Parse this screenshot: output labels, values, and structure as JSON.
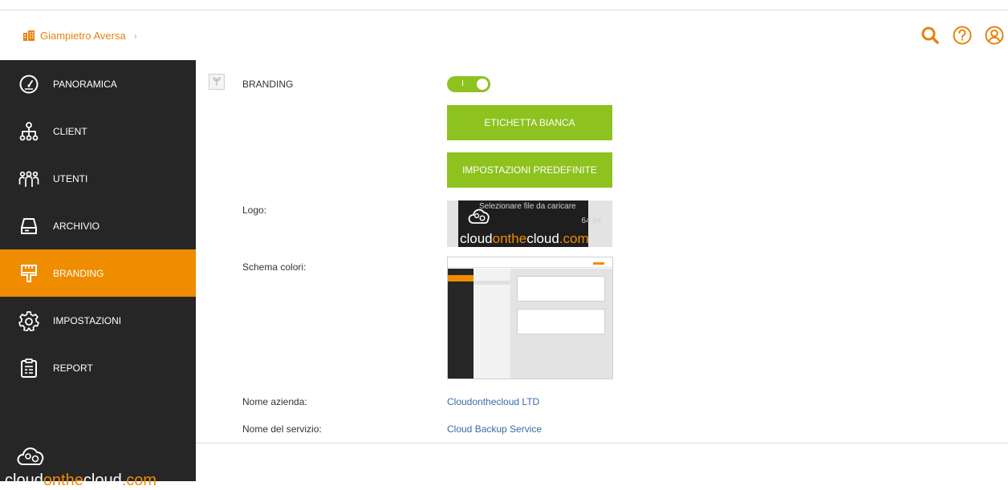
{
  "header": {
    "breadcrumb": "Giampietro Aversa",
    "breadcrumb_icon": "building-icon",
    "icons": [
      "search-icon",
      "help-icon",
      "user-icon"
    ],
    "accent_color": "#e8820c"
  },
  "sidebar": {
    "background": "#262626",
    "active_color": "#f08c00",
    "items": [
      {
        "label": "PANORAMICA",
        "icon": "dashboard-icon",
        "active": false
      },
      {
        "label": "CLIENT",
        "icon": "hierarchy-icon",
        "active": false
      },
      {
        "label": "UTENTI",
        "icon": "users-icon",
        "active": false
      },
      {
        "label": "ARCHIVIO",
        "icon": "storage-icon",
        "active": false
      },
      {
        "label": "BRANDING",
        "icon": "brush-icon",
        "active": true
      },
      {
        "label": "IMPOSTAZIONI",
        "icon": "gear-icon",
        "active": false
      },
      {
        "label": "REPORT",
        "icon": "clipboard-icon",
        "active": false
      }
    ],
    "logo": {
      "part1": "cloud",
      "part2": "onthe",
      "part3": "cloud",
      "part4": ".com"
    }
  },
  "content": {
    "title": "BRANDING",
    "toggle": {
      "mark": "I",
      "on": true,
      "color": "#8dc21f"
    },
    "buttons": {
      "white_label": "ETICHETTA BIANCA",
      "defaults": "IMPOSTAZIONI PREDEFINITE"
    },
    "logo_field": {
      "label": "Logo:",
      "hint": "Selezionare file da caricare",
      "size": "64 px",
      "word_part1": "cloud",
      "word_part2": "onthe",
      "word_part3": "cloud",
      "word_part4": ".com"
    },
    "scheme_label": "Schema colori:",
    "company": {
      "label": "Nome azienda:",
      "value": "Cloudonthecloud LTD"
    },
    "service": {
      "label": "Nome del servizio:",
      "value": "Cloud Backup Service"
    }
  }
}
